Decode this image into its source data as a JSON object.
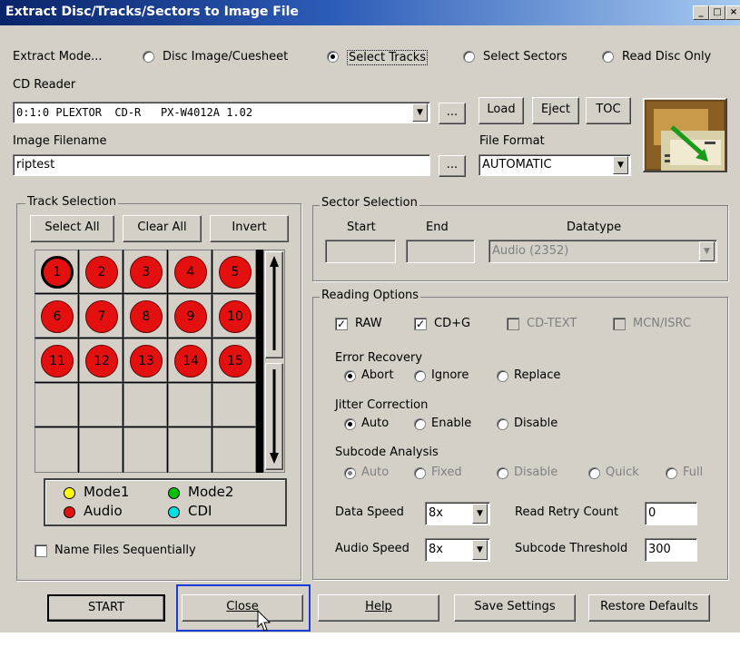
{
  "window": {
    "title": "Extract Disc/Tracks/Sectors to Image File"
  },
  "extract_mode": {
    "label": "Extract Mode...",
    "options": [
      "Disc Image/Cuesheet",
      "Select Tracks",
      "Select Sectors",
      "Read Disc Only"
    ],
    "selected": "Select Tracks"
  },
  "cd_reader": {
    "label": "CD Reader",
    "value": "0:1:0 PLEXTOR  CD-R   PX-W4012A 1.02",
    "browse": "...",
    "load": "Load",
    "eject": "Eject",
    "toc": "TOC"
  },
  "image_filename": {
    "label": "Image Filename",
    "value": "riptest",
    "browse": "..."
  },
  "file_format": {
    "label": "File Format",
    "value": "AUTOMATIC"
  },
  "track_selection": {
    "label": "Track Selection",
    "select_all": "Select All",
    "clear_all": "Clear All",
    "invert": "Invert",
    "tracks": [
      "1",
      "2",
      "3",
      "4",
      "5",
      "6",
      "7",
      "8",
      "9",
      "10",
      "11",
      "12",
      "13",
      "14",
      "15"
    ],
    "selected_track": "1",
    "legend": {
      "mode1": "Mode1",
      "mode2": "Mode2",
      "audio": "Audio",
      "cdi": "CDI"
    },
    "colors": {
      "mode1": "#ffff00",
      "mode2": "#00c000",
      "audio": "#e41010",
      "cdi": "#00e0e0"
    }
  },
  "name_files_sequentially": {
    "label": "Name Files Sequentially",
    "checked": false
  },
  "sector_selection": {
    "label": "Sector Selection",
    "start": "Start",
    "end": "End",
    "datatype": "Datatype",
    "datatype_value": "Audio (2352)"
  },
  "reading_options": {
    "label": "Reading Options",
    "raw": "RAW",
    "cdg": "CD+G",
    "cdtext": "CD-TEXT",
    "mcn": "MCN/ISRC",
    "error_recovery": {
      "label": "Error Recovery",
      "options": [
        "Abort",
        "Ignore",
        "Replace"
      ],
      "selected": "Abort"
    },
    "jitter": {
      "label": "Jitter Correction",
      "options": [
        "Auto",
        "Enable",
        "Disable"
      ],
      "selected": "Auto"
    },
    "subcode": {
      "label": "Subcode Analysis",
      "options": [
        "Auto",
        "Fixed",
        "Disable",
        "Quick",
        "Full"
      ],
      "selected": "Auto"
    },
    "data_speed": {
      "label": "Data Speed",
      "value": "8x"
    },
    "audio_speed": {
      "label": "Audio Speed",
      "value": "8x"
    },
    "read_retry": {
      "label": "Read Retry Count",
      "value": "0"
    },
    "subcode_threshold": {
      "label": "Subcode Threshold",
      "value": "300"
    }
  },
  "buttons": {
    "start": "START",
    "close": "Close",
    "help": "Help",
    "save": "Save Settings",
    "restore": "Restore Defaults"
  }
}
